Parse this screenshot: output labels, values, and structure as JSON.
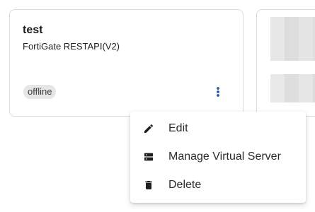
{
  "card": {
    "title": "test",
    "subtitle": "FortiGate RESTAPI(V2)",
    "status": "offline"
  },
  "menu": {
    "items": [
      {
        "label": "Edit",
        "icon": "pencil-icon"
      },
      {
        "label": "Manage Virtual Server",
        "icon": "server-icon"
      },
      {
        "label": "Delete",
        "icon": "trash-icon"
      }
    ]
  },
  "colors": {
    "badge_bg": "#e6e6e6",
    "kebab": "#2455a6",
    "card_border": "#dcdcdc"
  }
}
